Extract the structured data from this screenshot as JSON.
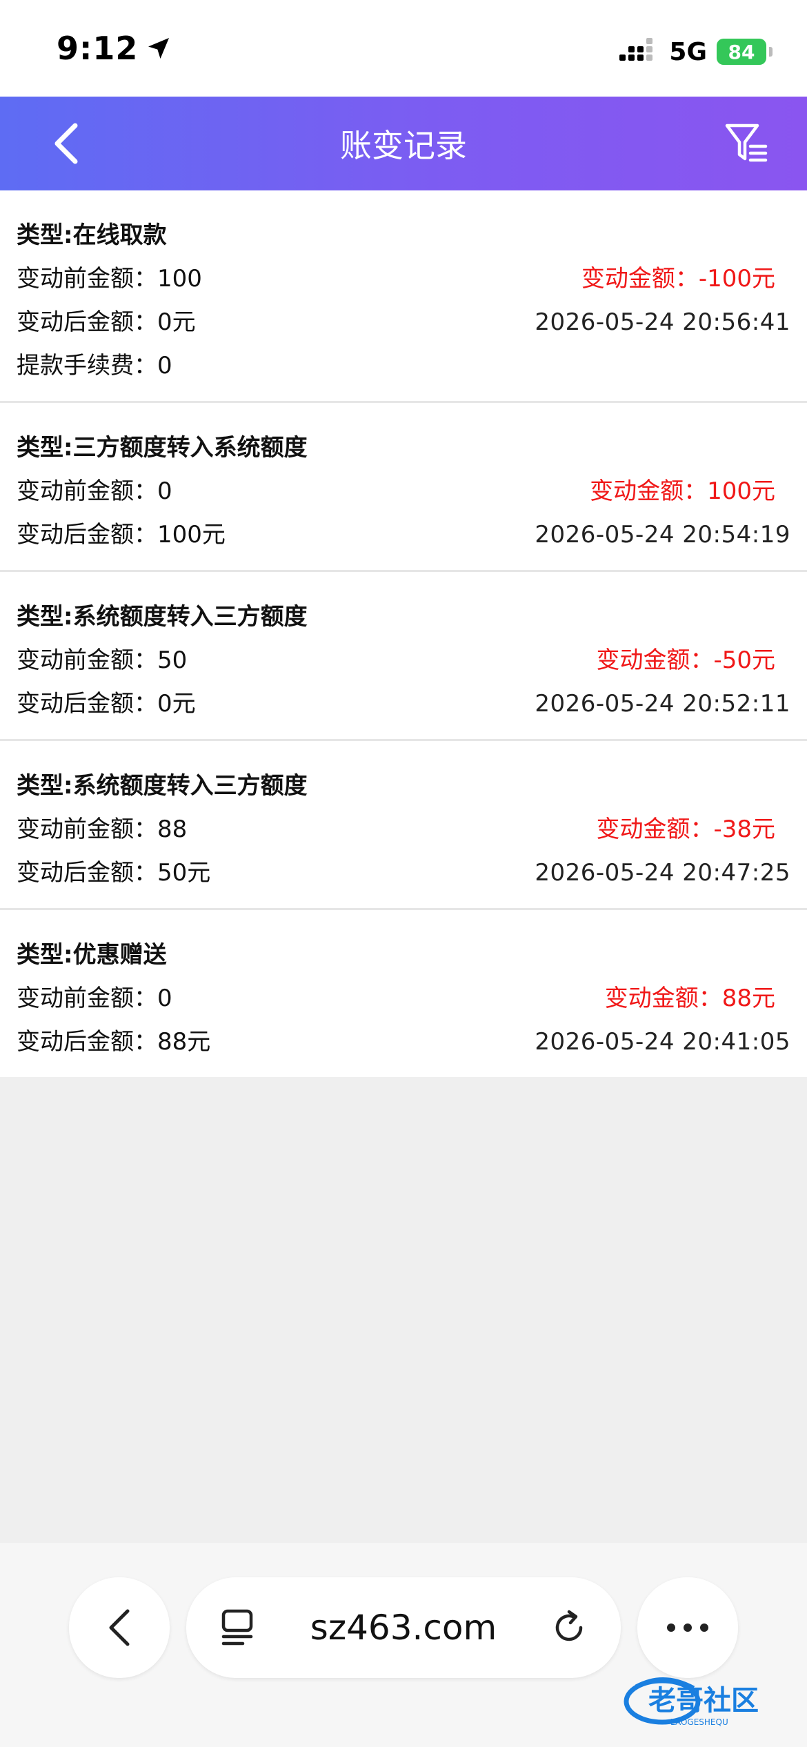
{
  "status_bar": {
    "time": "9:12",
    "network": "5G",
    "battery": "84"
  },
  "header": {
    "title": "账变记录"
  },
  "records": [
    {
      "type": "类型:在线取款",
      "before": "变动前金额：100",
      "after": "变动后金额：0元",
      "change": "变动金额：-100元",
      "time": "2026-05-24 20:56:41",
      "fee": "提款手续费：0"
    },
    {
      "type": "类型:三方额度转入系统额度",
      "before": "变动前金额：0",
      "after": "变动后金额：100元",
      "change": "变动金额：100元",
      "time": "2026-05-24 20:54:19"
    },
    {
      "type": "类型:系统额度转入三方额度",
      "before": "变动前金额：50",
      "after": "变动后金额：0元",
      "change": "变动金额：-50元",
      "time": "2026-05-24 20:52:11"
    },
    {
      "type": "类型:系统额度转入三方额度",
      "before": "变动前金额：88",
      "after": "变动后金额：50元",
      "change": "变动金额：-38元",
      "time": "2026-05-24 20:47:25"
    },
    {
      "type": "类型:优惠赠送",
      "before": "变动前金额：0",
      "after": "变动后金额：88元",
      "change": "变动金额：88元",
      "time": "2026-05-24 20:41:05"
    }
  ],
  "browser": {
    "url": "sz463.com"
  },
  "watermark": {
    "text": "老哥社区",
    "subtext": "LAOGESHEQU"
  },
  "colors": {
    "header_gradient_start": "#5e6cf3",
    "header_gradient_end": "#8a55f0",
    "amount_red": "#f01818",
    "battery_green": "#34c759"
  },
  "icons": {
    "back": "chevron-left-icon",
    "filter": "filter-icon",
    "tabs": "tabs-icon",
    "reload": "reload-icon",
    "more": "more-icon"
  }
}
